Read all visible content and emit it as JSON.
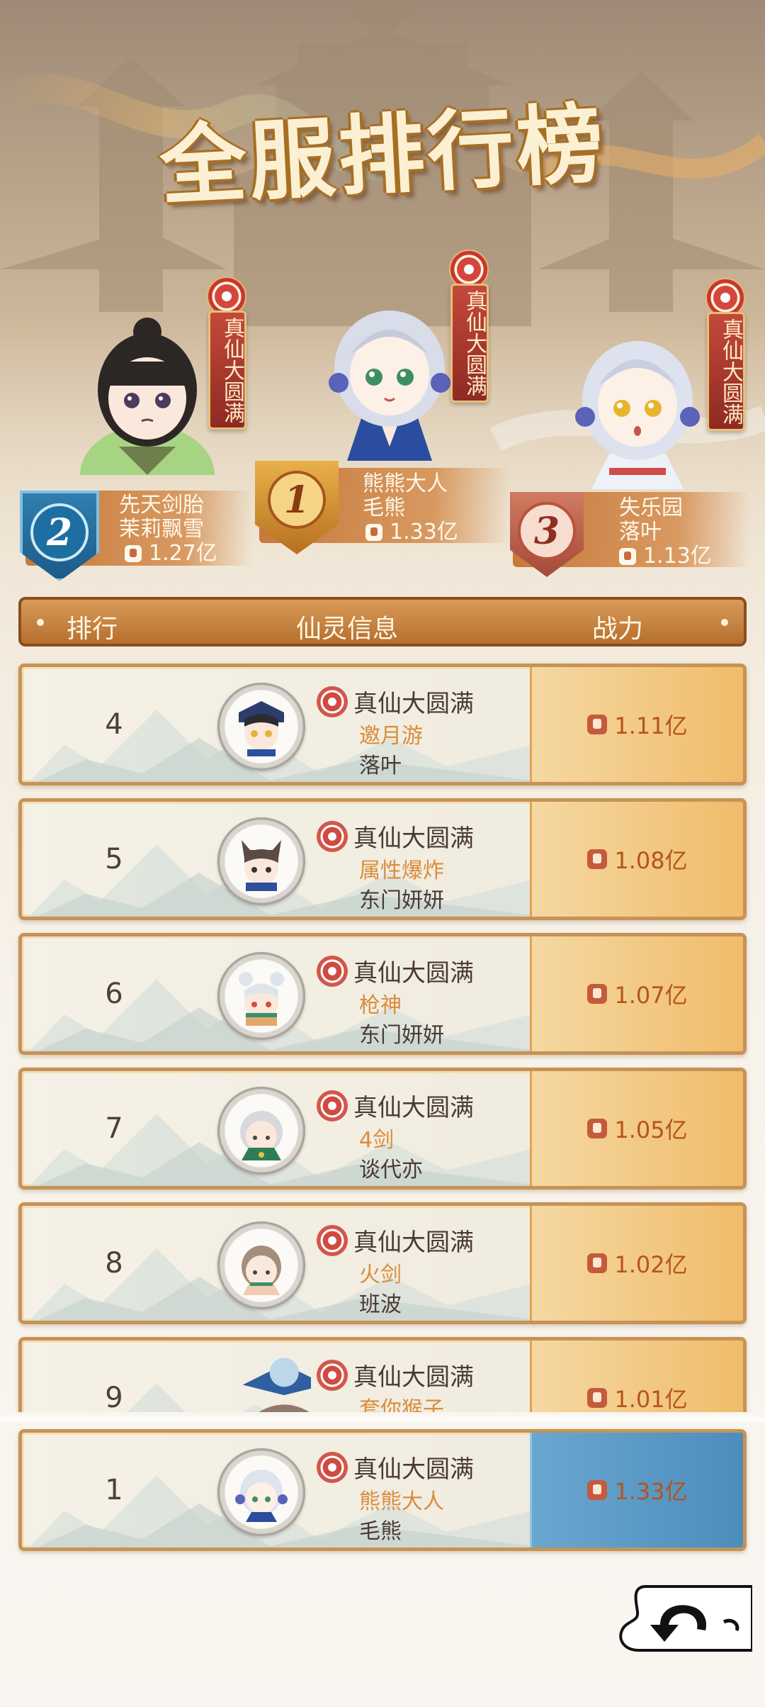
{
  "page": {
    "title": "全服排行榜"
  },
  "podium": [
    {
      "rank": "2",
      "realm": "真仙大圆满",
      "guild": "先天剑胎",
      "name": "茉莉飘雪",
      "power": "1.27亿"
    },
    {
      "rank": "1",
      "realm": "真仙大圆满",
      "guild": "熊熊大人",
      "name": "毛熊",
      "power": "1.33亿"
    },
    {
      "rank": "3",
      "realm": "真仙大圆满",
      "guild": "失乐园",
      "name": "落叶",
      "power": "1.13亿"
    }
  ],
  "table": {
    "headers": {
      "rank": "排行",
      "info": "仙灵信息",
      "power": "战力"
    },
    "rows": [
      {
        "rank": "4",
        "realm": "真仙大圆满",
        "name": "邀月游",
        "guild": "落叶",
        "power": "1.11亿"
      },
      {
        "rank": "5",
        "realm": "真仙大圆满",
        "name": "属性爆炸",
        "guild": "东门妍妍",
        "power": "1.08亿"
      },
      {
        "rank": "6",
        "realm": "真仙大圆满",
        "name": "枪神",
        "guild": "东门妍妍",
        "power": "1.07亿"
      },
      {
        "rank": "7",
        "realm": "真仙大圆满",
        "name": "4剑",
        "guild": "谈代亦",
        "power": "1.05亿"
      },
      {
        "rank": "8",
        "realm": "真仙大圆满",
        "name": "火剑",
        "guild": "班波",
        "power": "1.02亿"
      },
      {
        "rank": "9",
        "realm": "真仙大圆满",
        "name": "套你猴子",
        "guild": "",
        "power": "1.01亿"
      }
    ]
  },
  "self_row": {
    "rank": "1",
    "realm": "真仙大圆满",
    "name": "熊熊大人",
    "guild": "毛熊",
    "power": "1.33亿"
  },
  "colors": {
    "accent": "#d98d3c",
    "header": "#c17c38",
    "self_highlight": "#5b9ac6"
  },
  "icons": {
    "realm": "red-flower-emblem-icon",
    "power": "combat-power-icon",
    "back": "back-arrow-icon"
  }
}
